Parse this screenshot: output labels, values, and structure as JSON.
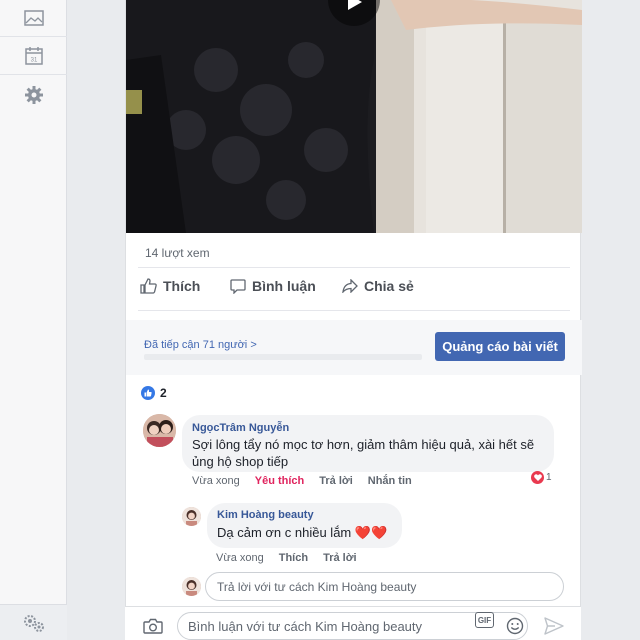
{
  "post": {
    "views": "14 lượt xem",
    "actions": {
      "like": "Thích",
      "comment": "Bình luận",
      "share": "Chia sẻ"
    },
    "reach": {
      "text": "Đã tiếp cận 71 người",
      "chevron": ">",
      "promote_label": "Quảng cáo bài viết"
    },
    "reactions": {
      "count": "2"
    }
  },
  "comments": [
    {
      "author": "NgọcTrâm Nguyễn",
      "lines": [
        "Sợi lông tẩy nó mọc tơ hơn, giảm thâm hiệu quả, xài hết sẽ",
        "ủng hộ shop tiếp"
      ],
      "time": "Vừa xong",
      "like_label": "Yêu thích",
      "reply_label": "Trả lời",
      "message_label": "Nhắn tin",
      "reaction_count": "1"
    }
  ],
  "reply": {
    "author": "Kim Hoàng beauty",
    "text": "Dạ cảm ơn c nhiều lắm",
    "emoji": "❤️❤️",
    "time": "Vừa xong",
    "like_label": "Thích",
    "reply_label": "Trả lời"
  },
  "reply_input": {
    "placeholder": "Trả lời với tư cách Kim Hoàng beauty"
  },
  "composer": {
    "placeholder": "Bình luận với tư cách Kim Hoàng beauty",
    "gif_label": "GIF"
  },
  "icons": {
    "rail": [
      "image-icon",
      "calendar-icon",
      "gear-icon"
    ],
    "rail_bottom": "settings-gears-icon",
    "calendar_day": "31"
  },
  "colors": {
    "accent": "#4267b2",
    "heart": "#e9394f",
    "love_text": "#e0245e"
  }
}
